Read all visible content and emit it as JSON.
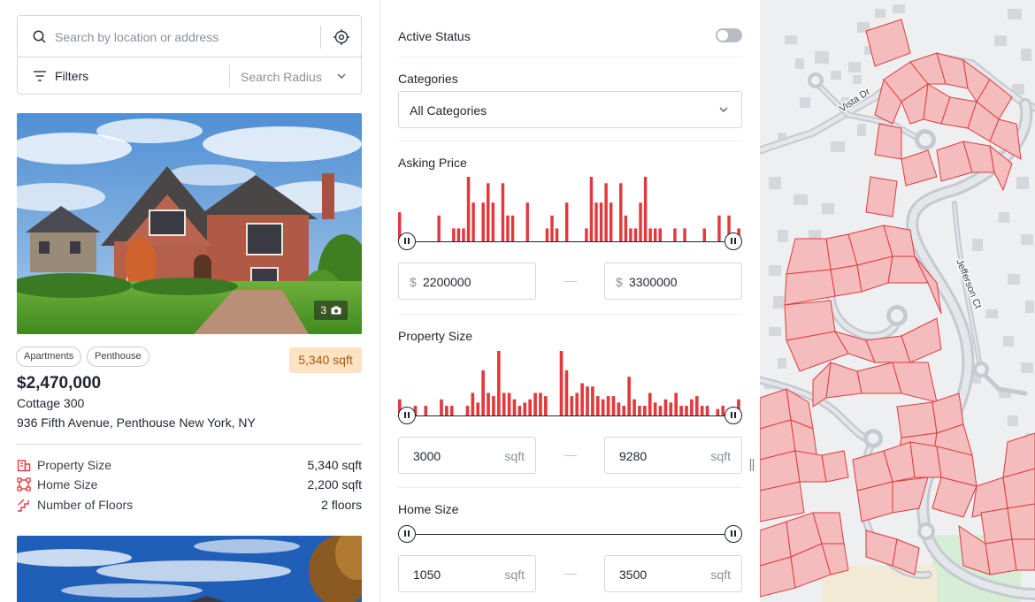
{
  "search": {
    "placeholder": "Search by location or address"
  },
  "filters": {
    "label": "Filters",
    "radius_placeholder": "Search Radius"
  },
  "listing": {
    "photo_count": "3",
    "tags": [
      "Apartments",
      "Penthouse"
    ],
    "size_badge": "5,340 sqft",
    "price": "$2,470,000",
    "title": "Cottage 300",
    "address": "936 Fifth Avenue, Penthouse New York, NY",
    "specs": [
      {
        "label": "Property Size",
        "value": "5,340 sqft",
        "icon": "building-icon"
      },
      {
        "label": "Home Size",
        "value": "2,200 sqft",
        "icon": "frame-icon"
      },
      {
        "label": "Number of Floors",
        "value": "2 floors",
        "icon": "stairs-icon"
      }
    ]
  },
  "panel": {
    "active_status": {
      "label": "Active Status",
      "enabled": false
    },
    "categories": {
      "label": "Categories",
      "value": "All Categories"
    },
    "asking_price": {
      "label": "Asking Price",
      "currency_symbol": "$",
      "min": "2200000",
      "max": "3300000",
      "histogram": [
        0.45,
        0,
        0,
        0,
        0,
        0,
        0,
        0,
        0.4,
        0,
        0,
        0.2,
        0.2,
        0.2,
        1,
        0.6,
        0,
        0.6,
        0.9,
        0.6,
        0,
        0.9,
        0.4,
        0.4,
        0,
        0,
        0.6,
        0,
        0,
        0,
        0.2,
        0.4,
        0.2,
        0,
        0.6,
        0,
        0,
        0,
        0.2,
        1,
        0.6,
        0.6,
        0.9,
        0.6,
        0,
        0.9,
        0.4,
        0.2,
        0.2,
        0.6,
        1,
        0.2,
        0.2,
        0.2,
        0,
        0,
        0.2,
        0,
        0.2,
        0,
        0,
        0,
        0.2,
        0,
        0,
        0.4,
        0,
        0.4,
        0,
        0.2
      ]
    },
    "property_size": {
      "label": "Property Size",
      "unit": "sqft",
      "min": "3000",
      "max": "9280",
      "histogram": [
        0.25,
        0,
        0,
        0.15,
        0,
        0.15,
        0,
        0,
        0.25,
        0.15,
        0.15,
        0,
        0,
        0.15,
        0.35,
        0.2,
        0.7,
        0.35,
        0.3,
        1,
        0.35,
        0.35,
        0.25,
        0.15,
        0.2,
        0.25,
        0.35,
        0.35,
        0.3,
        0,
        0,
        1,
        0.7,
        0.3,
        0.35,
        0.5,
        0.45,
        0.45,
        0.3,
        0.25,
        0.3,
        0.3,
        0.2,
        0.15,
        0.6,
        0.25,
        0.15,
        0.15,
        0.35,
        0.2,
        0.15,
        0.25,
        0.2,
        0.35,
        0.15,
        0.15,
        0.25,
        0.3,
        0.15,
        0.15,
        0,
        0.1,
        0.15,
        0,
        0,
        0.25
      ]
    },
    "home_size": {
      "label": "Home Size",
      "unit": "sqft",
      "min": "1050",
      "max": "3500"
    }
  },
  "map": {
    "streets": [
      "Vista Dr",
      "Jefferson Ct"
    ],
    "colors": {
      "parcel_fill": "#f4bcbc",
      "parcel_stroke": "#e2393c",
      "road": "#c5cad2",
      "park": "#d6edd6",
      "lot": "#f3ead6",
      "building": "#d4d7dc"
    }
  },
  "colors": {
    "accent": "#e2393c",
    "badge_bg": "#fde3c1",
    "badge_text": "#a05a12"
  }
}
